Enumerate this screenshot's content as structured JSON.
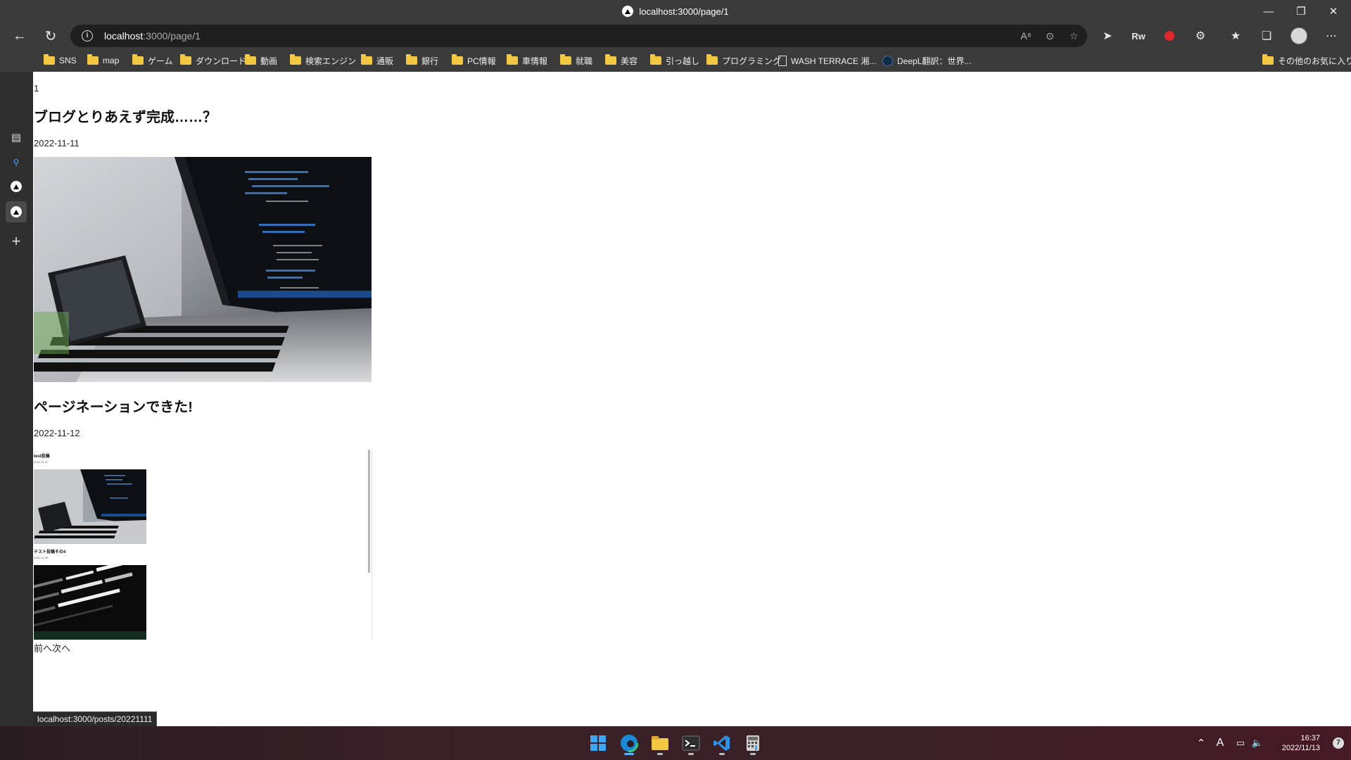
{
  "window": {
    "title": "localhost:3000/page/1",
    "controls": [
      "minimize-icon",
      "restore-icon",
      "close-icon"
    ]
  },
  "navigation": {
    "url_host": "localhost",
    "url_rest": ":3000/page/1",
    "icons": [
      "back-icon",
      "refresh-icon",
      "info-icon",
      "read-aloud-icon",
      "zoom-out-icon",
      "add-favorite-icon",
      "extension-icon",
      "rw-extension-icon",
      "red-extension-icon",
      "extensions-icon",
      "favorites-icon",
      "collections-icon",
      "profile-avatar",
      "more-icon"
    ],
    "rw_label": "Rw"
  },
  "bookmarks": {
    "items": [
      {
        "label": "SNS",
        "type": "folder"
      },
      {
        "label": "map",
        "type": "folder"
      },
      {
        "label": "ゲーム",
        "type": "folder"
      },
      {
        "label": "ダウンロード",
        "type": "folder"
      },
      {
        "label": "動画",
        "type": "folder"
      },
      {
        "label": "検索エンジン",
        "type": "folder"
      },
      {
        "label": "通販",
        "type": "folder"
      },
      {
        "label": "銀行",
        "type": "folder"
      },
      {
        "label": "PC情報",
        "type": "folder"
      },
      {
        "label": "車情報",
        "type": "folder"
      },
      {
        "label": "就職",
        "type": "folder"
      },
      {
        "label": "美容",
        "type": "folder"
      },
      {
        "label": "引っ越し",
        "type": "folder"
      },
      {
        "label": "プログラミング",
        "type": "folder"
      },
      {
        "label": "WASH TERRACE 湘...",
        "type": "page"
      },
      {
        "label": "DeepL翻訳：世界...",
        "type": "page"
      }
    ],
    "other": "その他のお気に入り"
  },
  "sidebar": {
    "icons": [
      "tabs-icon",
      "search-icon",
      "nextjs-logo-icon",
      "nextjs-logo-icon",
      "add-icon"
    ]
  },
  "page": {
    "page_number": "1",
    "posts": [
      {
        "title": "ブログとりあえず完成……？",
        "date": "2022-11-11",
        "image": "laptop-code-photo"
      },
      {
        "title": "ページネーションできた!",
        "date": "2022-11-12"
      }
    ],
    "embedded": {
      "posts": [
        {
          "title": "test投稿",
          "date": "2022-11-11",
          "image": "laptop-code-photo"
        },
        {
          "title": "テスト投稿その4",
          "date": "2022-11-06",
          "image": "code-closeup-photo"
        }
      ]
    },
    "pager": "前へ次へ"
  },
  "status_bar": {
    "url": "localhost:3000/posts/20221111"
  },
  "taskbar": {
    "apps": [
      "windows-start-icon",
      "edge-browser-icon",
      "file-explorer-icon",
      "terminal-icon",
      "vscode-icon",
      "calculator-icon"
    ],
    "tray": [
      "chevron-up-icon",
      "ime-icon",
      "network-icon",
      "volume-icon"
    ],
    "ime_label": "A",
    "time": "16:37",
    "date": "2022/11/13",
    "notifications": "7"
  }
}
